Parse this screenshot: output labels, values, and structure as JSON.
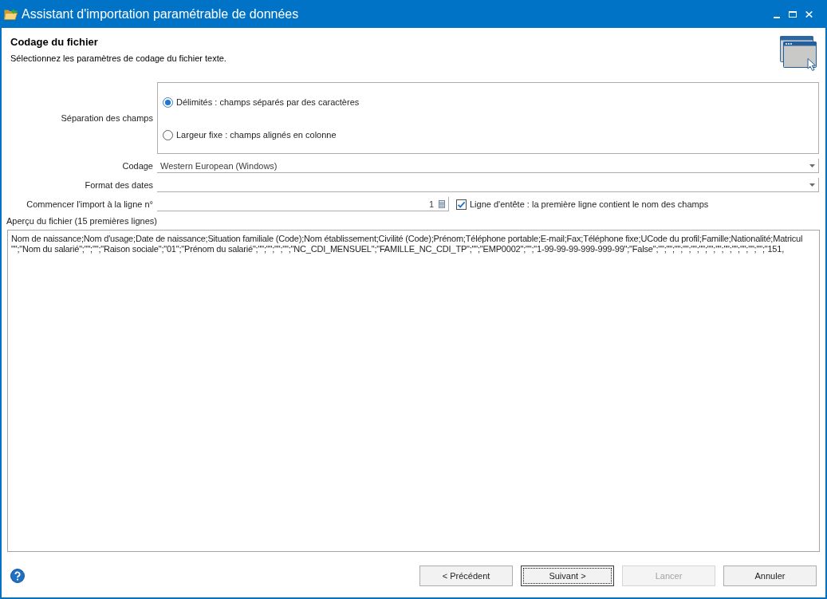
{
  "window": {
    "title": "Assistant d'importation paramétrable de données"
  },
  "header": {
    "title": "Codage du fichier",
    "subtitle": "Sélectionnez les paramètres de codage du fichier texte."
  },
  "field_separation": {
    "label": "Séparation des champs",
    "options": [
      {
        "label": "Délimités : champs séparés par des caractères",
        "selected": true
      },
      {
        "label": "Largeur fixe : champs alignés en colonne",
        "selected": false
      }
    ]
  },
  "encoding": {
    "label": "Codage",
    "value": "Western European (Windows)"
  },
  "date_format": {
    "label": "Format des dates"
  },
  "start_line": {
    "label": "Commencer l'import à la ligne n°",
    "value": "1"
  },
  "header_line": {
    "label": "Ligne d'entête : la première ligne contient le nom des champs",
    "checked": true
  },
  "preview": {
    "label": "Aperçu du fichier (15 premières lignes)",
    "lines": [
      "Nom de naissance;Nom d'usage;Date de naissance;Situation familiale (Code);Nom établissement;Civilité (Code);Prénom;Téléphone portable;E-mail;Fax;Téléphone fixe;UCode du profil;Famille;Nationalité;Matricul",
      "\"\";\"Nom du salarié\";\"\";\"\";\"Raison sociale\";\"01\";\"Prénom du salarié\";\"\";\"\";\"\";\"\";\"NC_CDI_MENSUEL\";\"FAMILLE_NC_CDI_TP\";\"\";\"EMP0002\";\"\";\"1-99-99-99-999-999-99\";\"False\";\"\";\"\";\"\";\"\";\"\";\"\";\"\";\"\";\"\";\"\";\"\";\"\";\"\";\"151,"
    ]
  },
  "buttons": [
    {
      "label": "< Précédent",
      "focused": false,
      "disabled": false
    },
    {
      "label": "Suivant >",
      "focused": true,
      "disabled": false
    },
    {
      "label": "Lancer",
      "focused": false,
      "disabled": true
    },
    {
      "label": "Annuler",
      "focused": false,
      "disabled": false
    }
  ]
}
